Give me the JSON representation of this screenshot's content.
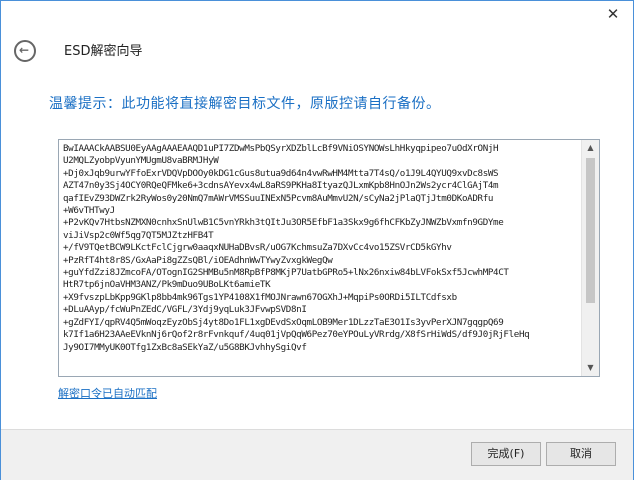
{
  "window": {
    "title": "ESD解密向导",
    "close_glyph": "✕",
    "back_glyph": "←"
  },
  "content": {
    "warning": "温馨提示：此功能将直接解密目标文件，原版控请自行备份。",
    "key_text": "BwIAAACkAABSU0EyAAgAAAEAAQD1uPI7ZDwMsPbQSyrXDZblLcBf9VNiOSYNOWsLhHkyqpipeo7uOdXrONjH\nU2MQLZyobpVyunYMUgmU8vaBRMJHyW\n+Dj0xJqb9urwYFfoExrVDQVpDOOy0kDG1cGus8utua9d64n4vwRwHM4Mtta7T4sQ/o1J9L4QYUQ9xvDc8sWS\nAZT47n0y3Sj4OCY0RQeQFMke6+3cdnsAYevx4wL8aRS9PKHa8ItyazQJLxmKpb8HnOJn2Ws2ycr4ClGAjT4m\nqafIEvZ93DWZrk2RyWos0y20NmQ7mAWrVMSSuuINExN5Pcvm8AuMmvU2N/sCyNa2jPlaQTjJtm0DKoADRfu\n+W6vTHTwyJ\n+P2vKQv7HtbsNZMXN0cnhxSnUlwB1C5vnYRkh3tQItJu3OR5EfbF1a3Skx9g6fhCFKbZyJNWZbVxmfn9GDYme\nviJiVsp2c0Wf5qg7QT5MJZtzHFB4T\n+/fV9TQetBCW9LKctFclCjgrw0aaqxNUHaDBvsR/uOG7KchmsuZa7DXvCc4vo15ZSVrCD5kGYhv\n+PzRfT4ht8r8S/GxAaPi8gZZsQBl/iOEAdhnWwTYwyZvxgkWegQw\n+guYfdZzi8JZmcoFA/OTognIG2SHMBu5nM8RpBfP8MKjP7UatbGPRo5+lNx26nxiw84bLVFokSxf5JcwhMP4CT\nHtR7tp6jnOaVHM3ANZ/Pk9mDuo9UBoLKt6amieTK\n+X9fvszpLbKpp9GKlp8bb4mk96Tgs1YP4108X1fMOJNrawn67OGXhJ+MqpiPs0ORDi5ILTCdfsxb\n+DLuAAyp/fcWuPnZEdC/VGFL/3Ydj9yqLuk3JFvwpSVD8nI\n+gZdFYI/qpRV4Q5mWoqzEyzObSj4yt8Do1FL1xgDEvdSxOqmLOB9Mer1DLzzTaE3O1Is3yvPerXJN7gqgpQ69\nk7If1a6H23AAeEVknNj6rQof2r8rFvnkquf/4uq01jVpQqW6Pez70eYPOuLyVRrdg/X8fSrHiWdS/df9J0jRjFleHq\nJy9OI7MMyUK0OTfg1ZxBc8aSEkYaZ/u5G8BKJvhhySgiQvf",
    "auto_match_link": "解密口令已自动匹配"
  },
  "footer": {
    "finish_label": "完成(F)",
    "cancel_label": "取消"
  },
  "scrollbar": {
    "up_glyph": "▲",
    "down_glyph": "▼"
  },
  "colors": {
    "accent": "#1a6fc4",
    "window_border": "#4a90d9",
    "footer_bg": "#f0f0f0"
  }
}
